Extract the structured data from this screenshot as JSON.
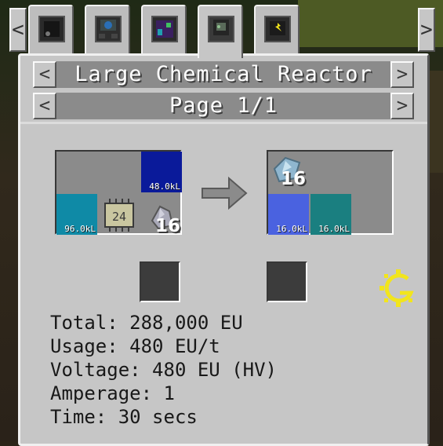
{
  "tabs": [
    {
      "name": "machine-1"
    },
    {
      "name": "machine-2"
    },
    {
      "name": "machine-3"
    },
    {
      "name": "machine-4",
      "active": true
    },
    {
      "name": "machine-5"
    }
  ],
  "tab_nav": {
    "prev": "<",
    "next": ">"
  },
  "header": {
    "title": "Large Chemical Reactor",
    "prev": "<",
    "next": ">"
  },
  "pager": {
    "label": "Page 1/1",
    "prev": "<",
    "next": ">"
  },
  "recipe": {
    "inputs": {
      "fluid_blue": {
        "amount": "48.0kL",
        "color": "#0a1a9a"
      },
      "fluid_cyan": {
        "amount": "96.0kL",
        "color": "#0f8aa6"
      },
      "circuit": {
        "label": "24"
      },
      "dust": {
        "count": "16"
      }
    },
    "outputs": {
      "item": {
        "count": "16"
      },
      "fluid_a": {
        "amount": "16.0kL",
        "color": "#4a62e0"
      },
      "fluid_b": {
        "amount": "16.0kL",
        "color": "#1a7f80"
      }
    },
    "arrow_icon": "right-arrow-icon",
    "brand_icon": "gregtech-logo-icon",
    "brand_color": "#f2e51c"
  },
  "info": {
    "total": "Total: 288,000 EU",
    "usage": "Usage: 480 EU/t",
    "voltage": "Voltage: 480 EU (HV)",
    "amperage": "Amperage: 1",
    "time": "Time: 30 secs"
  }
}
